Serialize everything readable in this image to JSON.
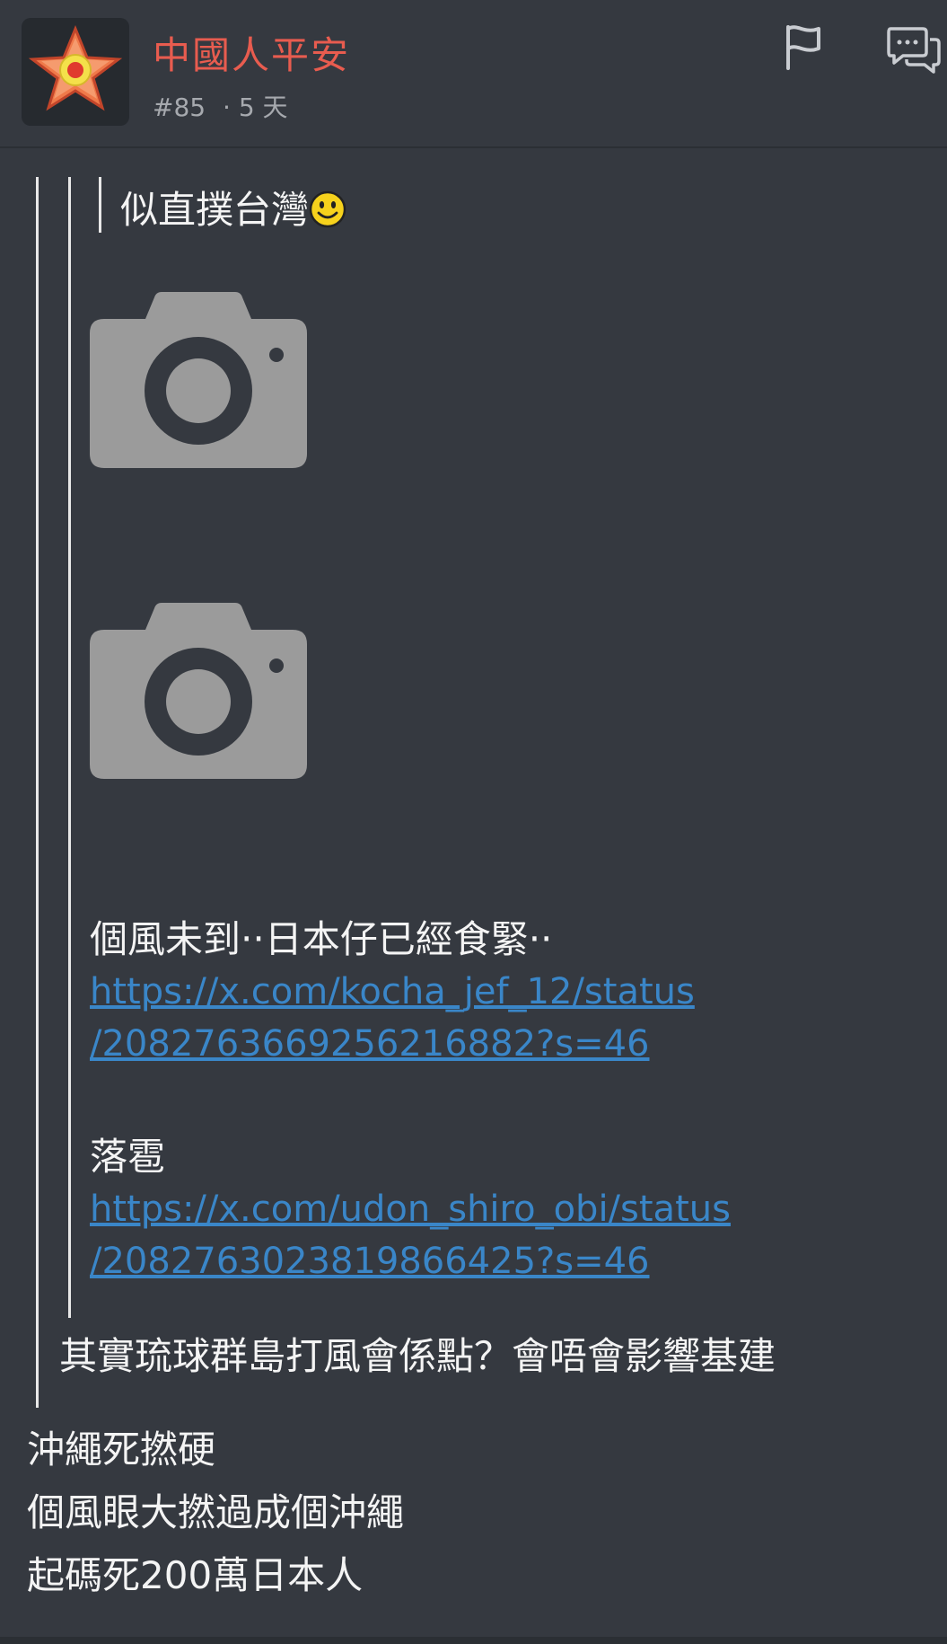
{
  "header": {
    "username": "中國人平安",
    "post_number": "#85",
    "separator": "·",
    "time_ago": "5 天",
    "flag_icon": "flag-icon",
    "reply_icon": "speech-bubbles-icon"
  },
  "quote_level3": {
    "text": "似直撲台灣",
    "emoji": "smiley-emoji"
  },
  "quote_level2": {
    "image_placeholders": [
      "camera-icon",
      "camera-icon"
    ],
    "caption1": "個風未到‧‧日本仔已經食緊‧‧",
    "link1_line1": "https://x.com/kocha_jef_12/status",
    "link1_line2": "/2082763669256216882?s=46",
    "caption2": "落雹",
    "link2_line1": "https://x.com/udon_shiro_obi/status",
    "link2_line2": "/2082763023819866425?s=46"
  },
  "quote_level1": {
    "text": "其實琉球群島打風會係點？會唔會影響基建"
  },
  "reply": {
    "lines": [
      "沖繩死撚硬",
      "個風眼大撚過成個沖繩",
      "起碼死200萬日本人"
    ]
  },
  "colors": {
    "background": "#353940",
    "username": "#e85c4f",
    "link": "#3a86c8",
    "meta": "#a6a9ae"
  }
}
